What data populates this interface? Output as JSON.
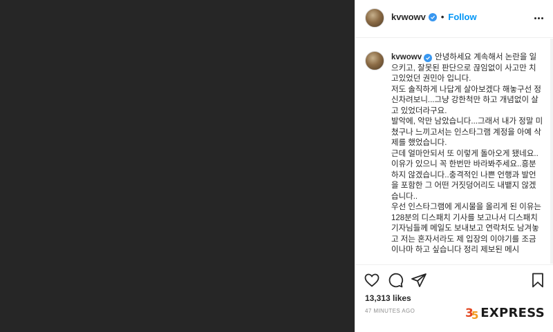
{
  "post": {
    "username": "kvwowv",
    "separator": "•",
    "follow_label": "Follow",
    "caption_username": "kvwowv",
    "caption_text": "안녕하세요 계속해서 논란을 일으키고, 잘못된 판단으로 끊임없이 사고만 치고있었던 권민아 입니다.\n저도 솔직하게 나답게 살아보겠다 해놓구선 정신차려보니...그냥 강한척만 하고 개념없이 살고 있었더라구요.\n발악에, 악만 남았습니다...그래서 내가 정말 미쳤구나 느끼고서는 인스타그램 계정을 아예 삭제를 했었습니다.\n근데 얼마안되서 또 이렇게 돌아오게 됐네요..이유가 있으니 꼭 한번만 바라봐주세요..흥분하지 않겠습니다..충격적인 나쁜 언행과 발언을 포함한 그 어떤 거짓덩어리도 내뱉지 않겠습니다..\n우선 인스타그램에 게시물을 올리게 된 이유는 128분의 디스패치 기사를 보고나서 디스패치 기자님들께 메일도 보내보고 연락처도 남겨놓고 저는 혼자서라도 제 입장의 이야기를 조금이나마 하고 싶습니다 정리 제보된 메시",
    "likes": "13,313 likes",
    "timestamp": "47 MINUTES AGO"
  },
  "icons": {
    "verified": "verified-badge-icon",
    "more": "more-options-icon",
    "like": "heart-icon",
    "comment": "comment-icon",
    "share": "paper-plane-icon",
    "save": "bookmark-icon"
  },
  "watermark": {
    "text": "EXPRESS"
  },
  "colors": {
    "media_bg": "#262626",
    "follow": "#0095f6",
    "verified": "#3897f0",
    "muted": "#8e8e8e"
  }
}
